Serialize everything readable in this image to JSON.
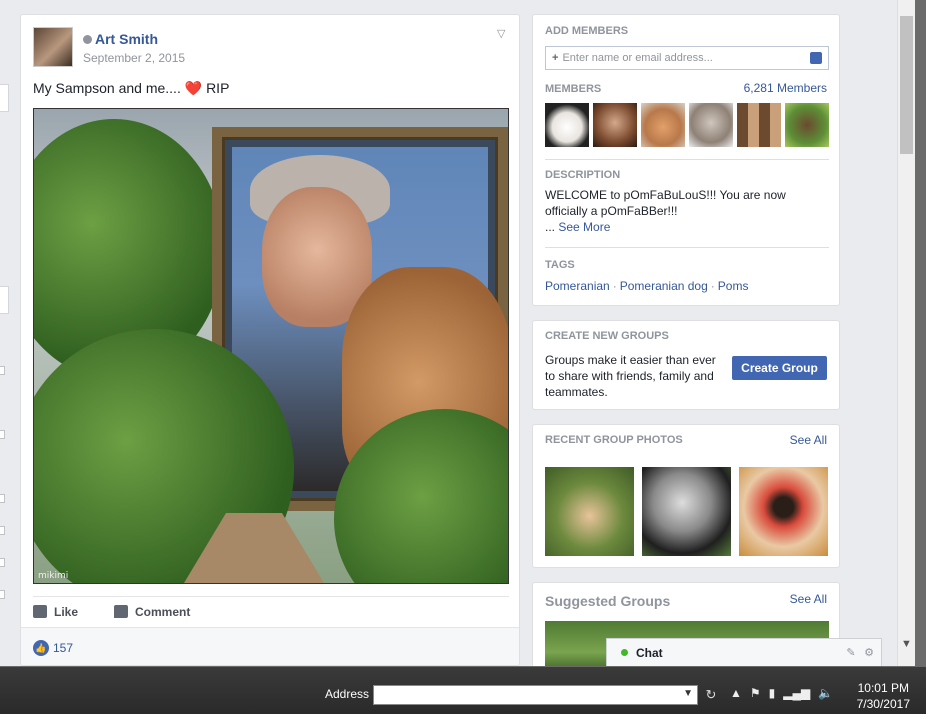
{
  "post": {
    "author": "Art Smith",
    "date": "September 2, 2015",
    "text": "My Sampson and me....",
    "emoji": "❤️",
    "text_after": "RIP",
    "watermark": "mikimi",
    "actions": {
      "like": "Like",
      "comment": "Comment"
    },
    "like_count": "157"
  },
  "about": {
    "add_members_title": "ADD MEMBERS",
    "add_members_placeholder": "Enter name or email address...",
    "members_title": "MEMBERS",
    "members_count": "6,281 Members",
    "description_title": "DESCRIPTION",
    "description_text": "WELCOME to pOmFaBuLouS!!! You are now officially a pOmFaBBer!!!",
    "see_more": "See More",
    "see_more_prefix": "...",
    "tags_title": "TAGS",
    "tags": [
      "Pomeranian",
      "Pomeranian dog",
      "Poms"
    ]
  },
  "create_groups": {
    "title": "CREATE NEW GROUPS",
    "text": "Groups make it easier than ever to share with friends, family and teammates.",
    "button": "Create Group"
  },
  "recent_photos": {
    "title": "RECENT GROUP PHOTOS",
    "see_all": "See All"
  },
  "suggested": {
    "title": "Suggested Groups",
    "see_all": "See All"
  },
  "chat": {
    "label": "Chat"
  },
  "taskbar": {
    "address_label": "Address",
    "time": "10:01 PM",
    "date": "7/30/2017"
  },
  "colors": {
    "link": "#365899",
    "button": "#4267b2",
    "online": "#42b72a",
    "background": "#e9ebee"
  }
}
